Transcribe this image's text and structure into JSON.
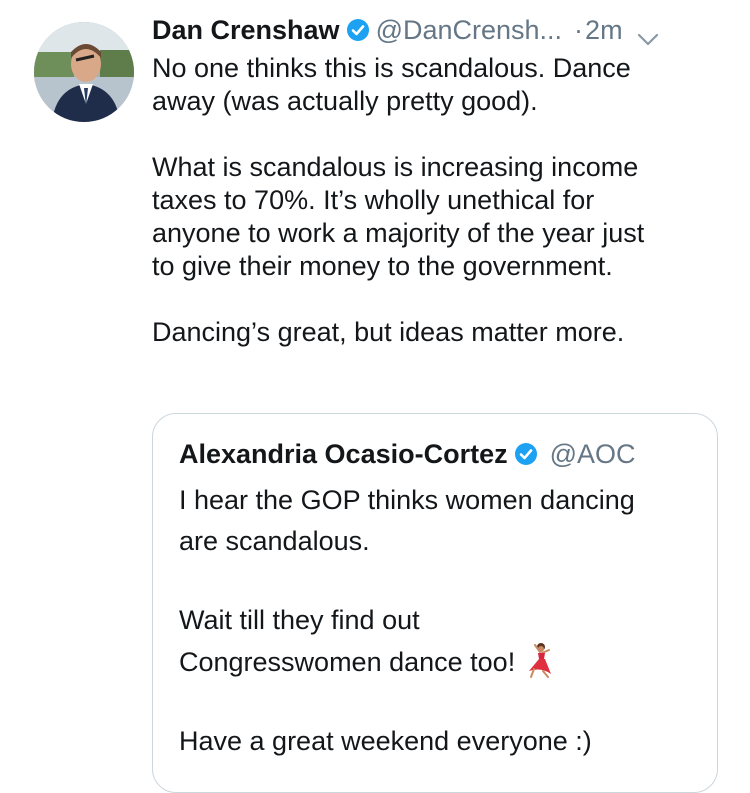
{
  "tweet": {
    "author": {
      "display_name": "Dan Crenshaw",
      "handle": "@DanCrensh...",
      "verified": true
    },
    "dot": "·",
    "time": "2m",
    "paragraphs": [
      [
        "No one thinks this is scandalous. Dance",
        "away (was actually pretty good)."
      ],
      [
        "What is scandalous is increasing income",
        "taxes to 70%. It’s wholly unethical for",
        "anyone to work a majority of the year just",
        "to give their money to the government."
      ],
      [
        "Dancing’s great, but ideas matter more."
      ]
    ]
  },
  "quoted_tweet": {
    "author": {
      "display_name": "Alexandria Ocasio-Cortez",
      "handle": "@AOC",
      "verified": true
    },
    "paragraphs": [
      [
        "I hear the GOP thinks women dancing",
        "are scandalous."
      ],
      [
        "Wait till they find out",
        "Congresswomen dance too!"
      ],
      [
        "Have a great weekend everyone :)"
      ]
    ],
    "emoji": "dancer-emoji"
  },
  "colors": {
    "text": "#14171a",
    "secondary": "#657786",
    "verified": "#1da1f2",
    "border": "#ccd6dd"
  }
}
